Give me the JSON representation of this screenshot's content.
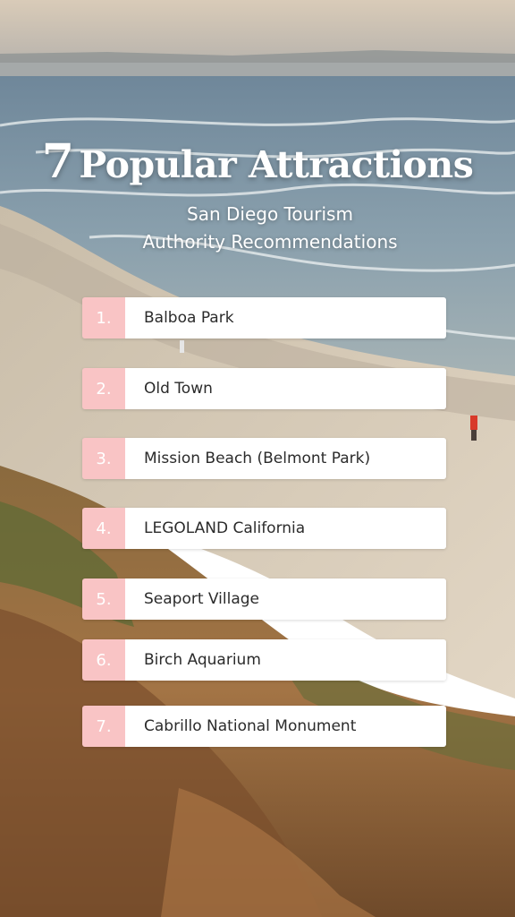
{
  "headline": {
    "number": "7",
    "text": "Popular Attractions"
  },
  "subtitle": {
    "line1": "San Diego Tourism",
    "line2": "Authority Recommendations"
  },
  "attractions": [
    {
      "rank": "1.",
      "name": "Balboa Park"
    },
    {
      "rank": "2.",
      "name": "Old Town"
    },
    {
      "rank": "3.",
      "name": "Mission Beach (Belmont Park)"
    },
    {
      "rank": "4.",
      "name": "LEGOLAND California"
    },
    {
      "rank": "5.",
      "name": "Seaport Village"
    },
    {
      "rank": "6.",
      "name": "Birch Aquarium"
    },
    {
      "rank": "7.",
      "name": "Cabrillo National Monument"
    }
  ],
  "colors": {
    "badge": "#f9c4c5",
    "label_bg": "#ffffff",
    "label_text": "#2b2b2b",
    "headline_text": "#ffffff"
  }
}
